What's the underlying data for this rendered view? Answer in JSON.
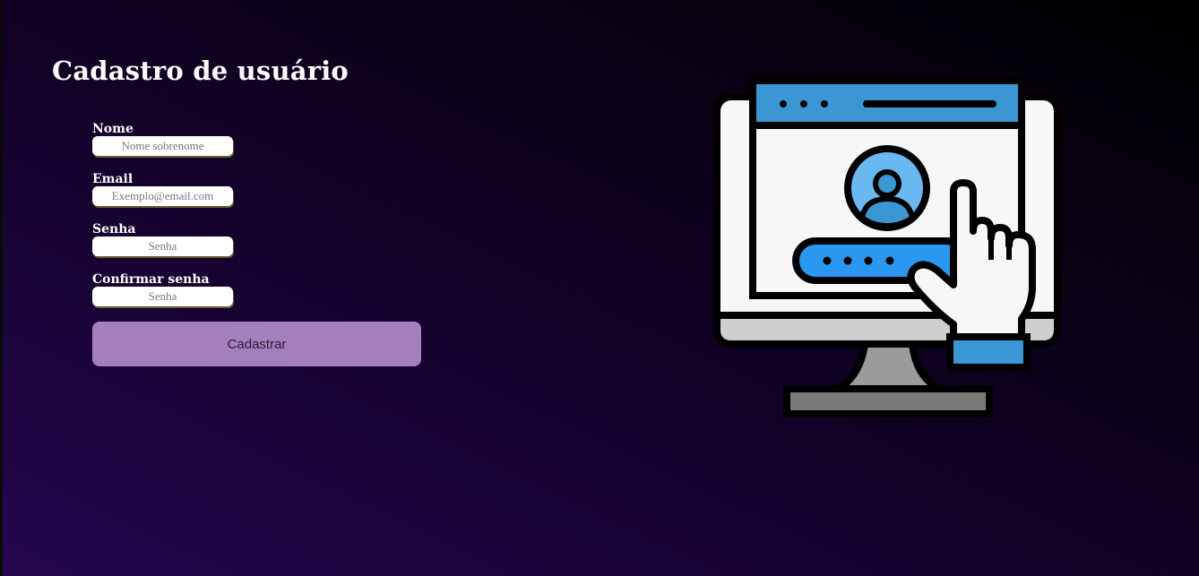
{
  "form": {
    "title": "Cadastro de usuário",
    "fields": [
      {
        "label": "Nome",
        "placeholder": "Nome sobrenome",
        "value": ""
      },
      {
        "label": "Email",
        "placeholder": "Exemplo@email.com",
        "value": ""
      },
      {
        "label": "Senha",
        "placeholder": "Senha",
        "value": ""
      },
      {
        "label": "Confirmar senha",
        "placeholder": "Senha",
        "value": ""
      }
    ],
    "submit_label": "Cadastrar"
  },
  "illustration": {
    "icon": "computer-login-hand-icon",
    "colors": {
      "blue": "#3b97d3",
      "light_blue": "#6ab8f2",
      "screen_bg": "#f7f7f7",
      "stand": "#9b9b9b",
      "base": "#7a7a7a",
      "outline": "#000000"
    }
  },
  "theme": {
    "button_color": "#a47ebd",
    "background_dark": "#000000",
    "background_purple": "#24064f"
  }
}
